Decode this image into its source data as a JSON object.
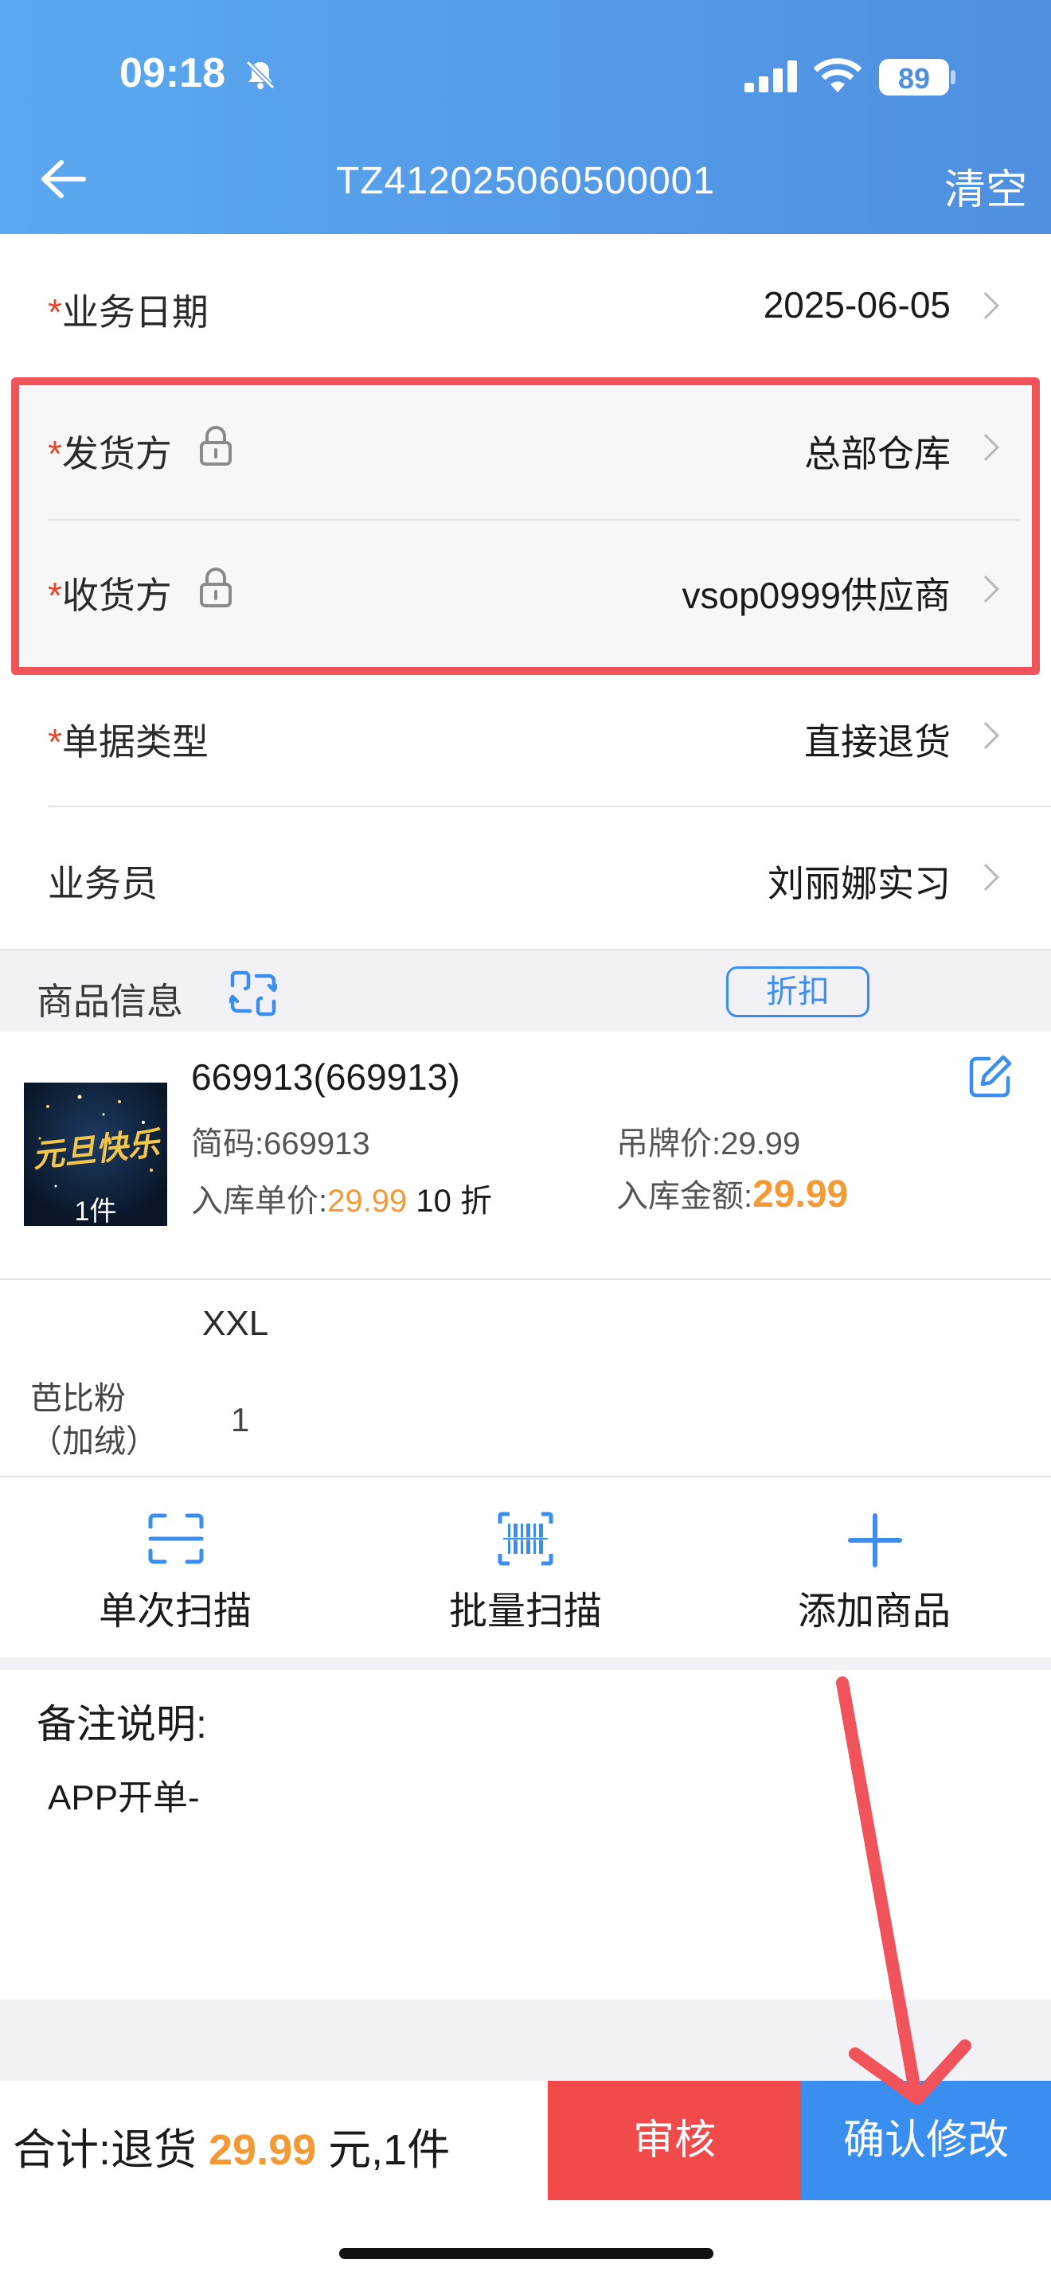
{
  "status": {
    "time": "09:18",
    "battery": "89"
  },
  "header": {
    "title": "TZ412025060500001",
    "clear_label": "清空"
  },
  "form": {
    "required_mark": "*",
    "business_date": {
      "label": "业务日期",
      "value": "2025-06-05"
    },
    "shipper": {
      "label": "发货方",
      "value": "总部仓库"
    },
    "receiver": {
      "label": "收货方",
      "value": "vsop0999供应商"
    },
    "doc_type": {
      "label": "单据类型",
      "value": "直接退货"
    },
    "salesperson": {
      "label": "业务员",
      "value": "刘丽娜实习"
    }
  },
  "goods": {
    "section_label": "商品信息",
    "discount_label": "折扣",
    "item": {
      "name": "669913(669913)",
      "qty_badge": "1件",
      "code_label": "简码:",
      "code_value": "669913",
      "tag_price_label": "吊牌价:",
      "tag_price_value": "29.99",
      "unit_price_label": "入库单价:",
      "unit_price_value": "29.99",
      "discount_value": "10 折",
      "amount_label": "入库金额:",
      "amount_value": "29.99",
      "thumb_text": "元旦快乐"
    },
    "size_header": "XXL",
    "color_line1": "芭比粉",
    "color_line2": "（加绒）",
    "color_qty": "1"
  },
  "actions": {
    "single_scan": "单次扫描",
    "batch_scan": "批量扫描",
    "add_goods": "添加商品"
  },
  "remark": {
    "label": "备注说明:",
    "value": "APP开单-"
  },
  "footer": {
    "total_prefix": "合计:退货 ",
    "total_amount": "29.99",
    "total_suffix": " 元,1件",
    "audit_label": "审核",
    "confirm_label": "确认修改"
  },
  "colors": {
    "accent": "#3a8ef0",
    "danger": "#f24a4a",
    "highlight_box": "#f0535a",
    "price": "#f39a36"
  }
}
